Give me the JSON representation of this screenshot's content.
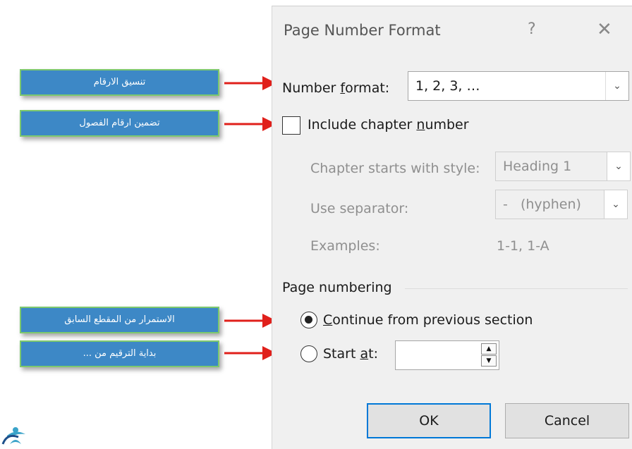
{
  "dialog": {
    "title": "Page Number Format",
    "help_glyph": "?",
    "close_glyph": "✕",
    "number_format": {
      "label_before": "Number ",
      "label_mnemonic": "f",
      "label_after": "ormat:",
      "value": "1, 2, 3, …"
    },
    "include_chapter": {
      "label_before": "Include chapter ",
      "label_mnemonic": "n",
      "label_after": "umber",
      "checked": false
    },
    "chapter_style": {
      "label": "Chapter starts with style:",
      "value": "Heading 1"
    },
    "separator": {
      "label": "Use separator:",
      "value": "-   (hyphen)"
    },
    "examples": {
      "label": "Examples:",
      "value": "1-1, 1-A"
    },
    "page_numbering": {
      "heading": "Page numbering",
      "continue": {
        "label_mnemonic": "C",
        "label_after": "ontinue from previous section",
        "selected": true
      },
      "start_at": {
        "label_before": "Start ",
        "label_mnemonic": "a",
        "label_after": "t:",
        "selected": false,
        "value": ""
      }
    },
    "ok_label": "OK",
    "cancel_label": "Cancel"
  },
  "callouts": [
    "تنسيق الارقام",
    "تضمين ارقام الفصول",
    "الاستمرار من المقطع السابق",
    "بداية الترقيم من ..."
  ],
  "colors": {
    "callout_fill": "#3d88c6",
    "callout_border": "#7dc86e",
    "arrow": "#e0201b",
    "ok_border": "#0078d7"
  },
  "icons": {
    "dropdown": "chevron-down-icon",
    "close": "close-icon",
    "help": "help-icon",
    "spin_up": "arrow-up-icon",
    "spin_down": "arrow-down-icon"
  }
}
